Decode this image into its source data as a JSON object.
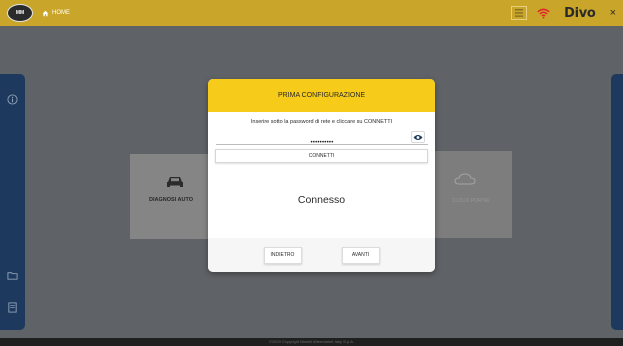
{
  "topbar": {
    "logo_text": "MAGNETI MARELLI",
    "home_label": "HOME",
    "brand": "Divo",
    "close_symbol": "×",
    "icons": {
      "home": "home-icon",
      "grid": "grid-icon",
      "wifi": "wifi-icon"
    }
  },
  "sidebar": {
    "icons": [
      "info-icon",
      "folder-icon",
      "document-icon"
    ]
  },
  "background_cards": [
    {
      "label": "DIAGNOSI AUTO",
      "icon": "car-icon"
    },
    {
      "label": "CLOUD PORTAL",
      "icon": "cloud-icon"
    }
  ],
  "modal": {
    "title": "PRIMA CONFIGURAZIONE",
    "instruction": "Inserire sotto la password di rete e cliccare su CONNETTI",
    "password_value": "••••••••••",
    "connect_label": "CONNETTI",
    "status": "Connesso",
    "back_label": "INDIETRO",
    "next_label": "AVANTI"
  },
  "footer": {
    "text": "©2020 Copyright Marelli Aftermarket Italy S.p.A."
  },
  "colors": {
    "topbar": "#c9a629",
    "modal_header": "#f6cb19",
    "rail": "#1d3a5e",
    "accent_red": "#e0242b"
  }
}
